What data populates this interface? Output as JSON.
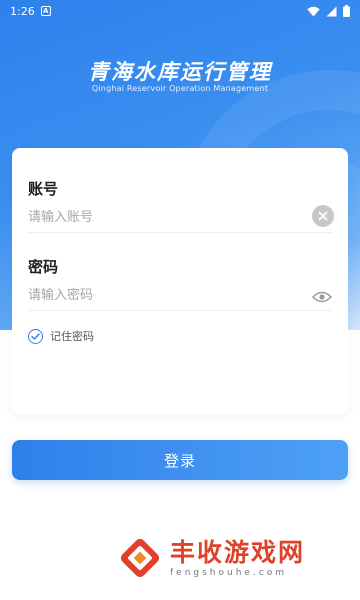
{
  "status_bar": {
    "time": "1:26",
    "notification_icon": "A"
  },
  "header": {
    "title": "青海水库运行管理",
    "subtitle": "Qinghai Reservoir Operation Management"
  },
  "form": {
    "account_label": "账号",
    "account_placeholder": "请输入账号",
    "account_value": "",
    "password_label": "密码",
    "password_placeholder": "请输入密码",
    "password_value": "",
    "remember_label": "记住密码",
    "remember_checked": true
  },
  "login_button_label": "登录",
  "watermark": {
    "name": "丰收游戏网",
    "domain": "fengshouhe.com"
  },
  "colors": {
    "primary": "#2e80ec",
    "watermark": "#e0412a"
  },
  "icons": [
    "wifi-icon",
    "signal-icon",
    "battery-icon",
    "clear-icon",
    "eye-icon",
    "check-circle-icon",
    "watermark-logo-icon"
  ]
}
